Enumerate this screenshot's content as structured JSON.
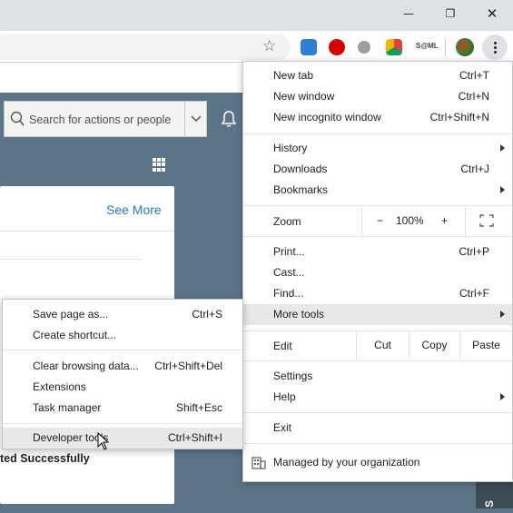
{
  "window": {
    "minimize_glyph": "—",
    "restore_glyph": "❐",
    "close_glyph": "✕"
  },
  "toolbar": {
    "bookmark_icon": "star-outline-icon",
    "extensions": [
      {
        "name": "cloud-extension-icon",
        "color": "#2f7fd0"
      },
      {
        "name": "adblock-extension-icon",
        "color": "#d50000"
      },
      {
        "name": "gray-circle-extension-icon",
        "color": "#9e9e9e"
      },
      {
        "name": "drive-extension-icon",
        "color": "#f4b400"
      }
    ],
    "extension_text": "S@ML",
    "menu_icon": "three-dots-vertical-icon"
  },
  "page": {
    "search_placeholder": "Search for actions or people",
    "see_more": "See More",
    "bold_text": "ted Successfully",
    "strip_text": "S"
  },
  "menu": {
    "new_tab": {
      "label": "New tab",
      "shortcut": "Ctrl+T"
    },
    "new_window": {
      "label": "New window",
      "shortcut": "Ctrl+N"
    },
    "new_incognito": {
      "label": "New incognito window",
      "shortcut": "Ctrl+Shift+N"
    },
    "history": {
      "label": "History"
    },
    "downloads": {
      "label": "Downloads",
      "shortcut": "Ctrl+J"
    },
    "bookmarks": {
      "label": "Bookmarks"
    },
    "zoom": {
      "label": "Zoom",
      "minus": "−",
      "value": "100%",
      "plus": "+"
    },
    "print": {
      "label": "Print...",
      "shortcut": "Ctrl+P"
    },
    "cast": {
      "label": "Cast..."
    },
    "find": {
      "label": "Find...",
      "shortcut": "Ctrl+F"
    },
    "more_tools": {
      "label": "More tools"
    },
    "edit": {
      "label": "Edit",
      "cut": "Cut",
      "copy": "Copy",
      "paste": "Paste"
    },
    "settings": {
      "label": "Settings"
    },
    "help": {
      "label": "Help"
    },
    "exit": {
      "label": "Exit"
    },
    "managed": {
      "label": "Managed by your organization"
    }
  },
  "submenu": {
    "save_page": {
      "label": "Save page as...",
      "shortcut": "Ctrl+S"
    },
    "create_shortcut": {
      "label": "Create shortcut..."
    },
    "clear_browsing": {
      "label": "Clear browsing data...",
      "shortcut": "Ctrl+Shift+Del"
    },
    "extensions": {
      "label": "Extensions"
    },
    "task_manager": {
      "label": "Task manager",
      "shortcut": "Shift+Esc"
    },
    "developer_tools": {
      "label": "Developer tools",
      "shortcut": "Ctrl+Shift+I"
    }
  },
  "colors": {
    "app_bar": "#5b7587",
    "link": "#2a7ab5",
    "menu_highlight": "#e8e8e9"
  }
}
